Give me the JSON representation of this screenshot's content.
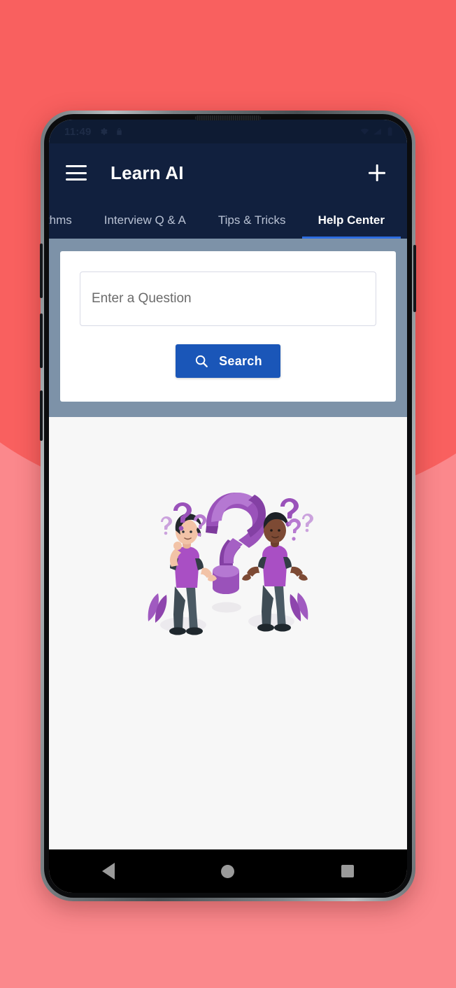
{
  "background": {
    "top_color": "#f9605f",
    "bottom_color": "#fb888c"
  },
  "device": {
    "frame_color": "#7a8084",
    "bezel_color": "#0b0c0e"
  },
  "status_bar": {
    "time": "11:49",
    "left_icons": [
      "gear-icon",
      "lock-icon"
    ],
    "right_icons": [
      "wifi-icon",
      "signal-icon",
      "battery-icon"
    ],
    "background": "#0e1b33"
  },
  "app_bar": {
    "menu_icon": "hamburger-menu-icon",
    "title": "Learn AI",
    "action_icon": "plus-icon",
    "background": "#11203e",
    "title_color": "#ffffff"
  },
  "tabs": {
    "active_index": 3,
    "underline_color": "#2d6de0",
    "items": [
      {
        "label": "orithms",
        "active": false
      },
      {
        "label": "Interview Q & A",
        "active": false
      },
      {
        "label": "Tips & Tricks",
        "active": false
      },
      {
        "label": "Help Center",
        "active": true
      }
    ]
  },
  "search_panel": {
    "panel_background": "#7d92a8",
    "card_background": "#ffffff",
    "input": {
      "value": "",
      "placeholder": "Enter a Question"
    },
    "button": {
      "label": "Search",
      "icon": "search-magnifier-icon",
      "color": "#1a56b8",
      "text_color": "#ffffff"
    }
  },
  "content": {
    "background": "#f7f7f7",
    "illustration": {
      "name": "confused-people-question-mark-illustration",
      "primary_color": "#9b51b5",
      "secondary_color": "#b77ad0",
      "accent_color": "#3d4a52"
    }
  },
  "nav_bar": {
    "background": "#000000",
    "icon_color": "#9a9a9a",
    "items": [
      {
        "name": "back-button",
        "icon": "triangle-left-icon"
      },
      {
        "name": "home-button",
        "icon": "circle-icon"
      },
      {
        "name": "recents-button",
        "icon": "square-icon"
      }
    ]
  }
}
